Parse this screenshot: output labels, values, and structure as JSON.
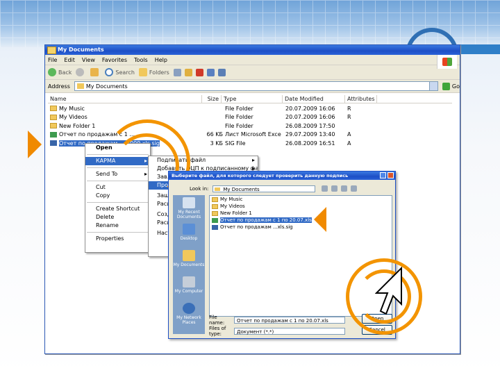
{
  "explorer": {
    "title": "My Documents",
    "menu": [
      "File",
      "Edit",
      "View",
      "Favorites",
      "Tools",
      "Help"
    ],
    "toolbar": {
      "back": "Back",
      "search": "Search",
      "folders": "Folders"
    },
    "address_label": "Address",
    "address_value": "My Documents",
    "go_label": "Go",
    "columns": [
      "Name",
      "Size",
      "Type",
      "Date Modified",
      "Attributes"
    ],
    "files": [
      {
        "name": "My Music",
        "size": "",
        "type": "File Folder",
        "date": "20.07.2009 16:06",
        "attr": "R",
        "icon": "folder-icon"
      },
      {
        "name": "My Videos",
        "size": "",
        "type": "File Folder",
        "date": "20.07.2009 16:06",
        "attr": "R",
        "icon": "folder-icon"
      },
      {
        "name": "New Folder 1",
        "size": "",
        "type": "File Folder",
        "date": "26.08.2009 17:50",
        "attr": "",
        "icon": "folder-icon"
      },
      {
        "name": "Отчет по продажам с 1 ...",
        "size": "66 KБ",
        "type": "Лист Microsoft Exce",
        "date": "29.07.2009 13:40",
        "attr": "A",
        "icon": "excel-file-icon"
      },
      {
        "name": "Отчет по продажам ... 2009.xls.sig",
        "size": "3 KБ",
        "type": "SIG File",
        "date": "26.08.2009 16:51",
        "attr": "A",
        "icon": "sig-file-icon"
      }
    ]
  },
  "context_menu": {
    "items": [
      "Open",
      "КАРМА",
      "Send To",
      "Cut",
      "Copy",
      "Create Shortcut",
      "Delete",
      "Rename",
      "Properties"
    ]
  },
  "submenu": {
    "items": [
      "Подписать файл",
      "Добавить ЭЦП к подписанному файлу",
      "Зав...",
      "Прове...",
      "Зашиф...",
      "Расш...",
      "Созд...",
      "Расш...",
      "Настр..."
    ]
  },
  "open_dialog": {
    "title": "Выберите файл, для которого следует проверить данную подпись",
    "look_in_label": "Look in:",
    "look_in_value": "My Documents",
    "places": [
      "My Recent Documents",
      "Desktop",
      "My Documents",
      "My Computer",
      "My Network Places"
    ],
    "files": [
      {
        "name": "My Music",
        "icon": "folder-icon"
      },
      {
        "name": "My Videos",
        "icon": "folder-icon"
      },
      {
        "name": "New Folder 1",
        "icon": "folder-icon"
      },
      {
        "name": "Отчет по продажам с 1 по 20.07.xls",
        "icon": "excel-file-icon"
      },
      {
        "name": "Отчет по продажам ...xls.sig",
        "icon": "sig-file-icon"
      }
    ],
    "file_name_label": "File name:",
    "file_name_value": "Отчет по продажам с 1 по 20.07.xls",
    "file_type_label": "Files of type:",
    "file_type_value": "Документ (*.*)",
    "open_button": "Open",
    "cancel_button": "Cancel"
  },
  "accent_color": "#f39400"
}
